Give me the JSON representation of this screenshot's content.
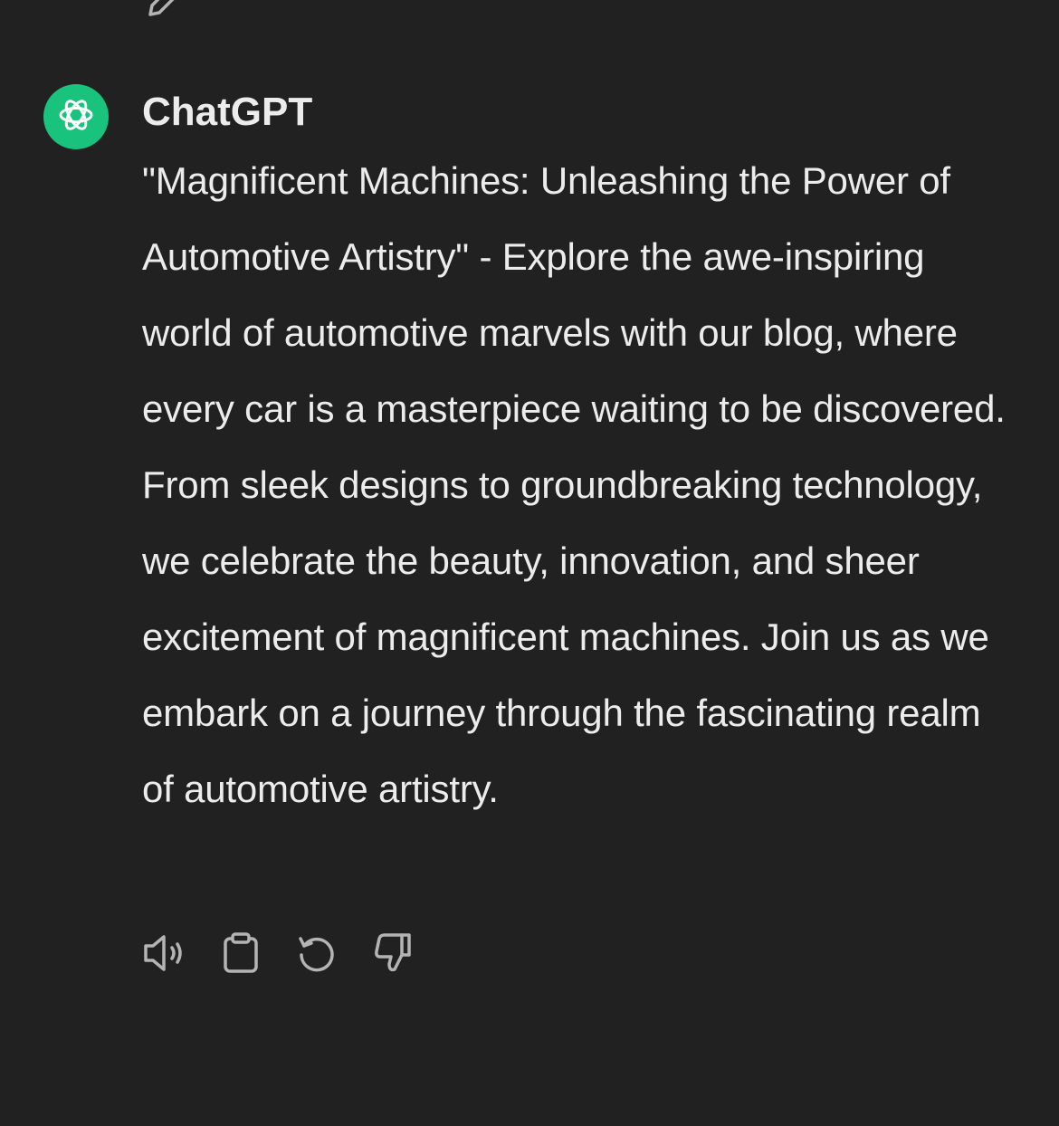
{
  "message": {
    "author": "ChatGPT",
    "text": "\"Magnificent Machines: Unleashing the Power of Automotive Artistry\" - Explore the awe-inspiring world of automotive marvels with our blog, where every car is a masterpiece waiting to be discovered. From sleek designs to groundbreaking technology, we celebrate the beauty, innovation, and sheer excitement of magnificent machines. Join us as we embark on a journey through the fascinating realm of automotive artistry."
  },
  "icons": {
    "avatar": "openai-logo-icon",
    "top": "edit-icon",
    "actions": [
      "read-aloud-icon",
      "copy-icon",
      "regenerate-icon",
      "thumbs-down-icon"
    ]
  },
  "colors": {
    "background": "#212121",
    "avatar": "#19c37d",
    "text": "#ececec",
    "icon": "#b4b4b4"
  }
}
